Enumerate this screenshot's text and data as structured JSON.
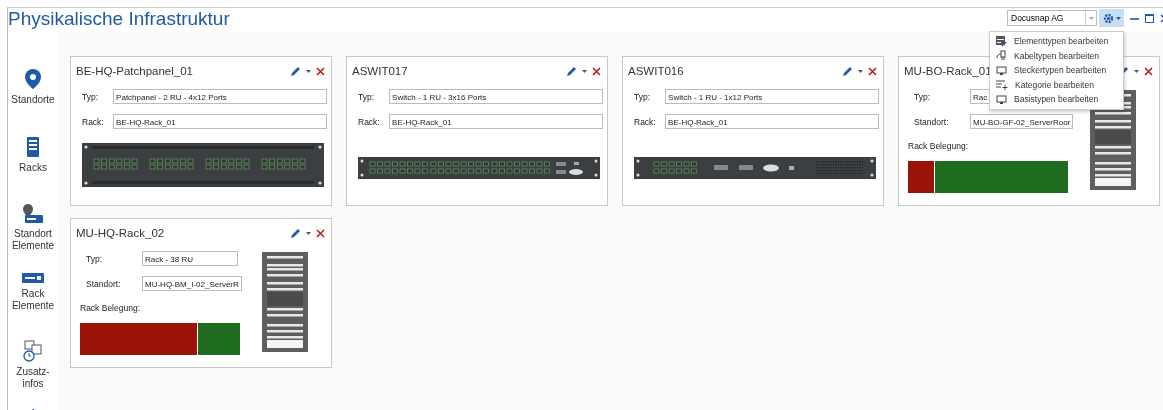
{
  "window": {
    "title": "Physikalische Infrastruktur"
  },
  "company_select": {
    "value": "Docusnap AG"
  },
  "settings_menu": {
    "expanded": true,
    "items": [
      {
        "label": "Elementtypen bearbeiten"
      },
      {
        "label": "Kabeltypen bearbeiten"
      },
      {
        "label": "Steckertypen bearbeiten"
      },
      {
        "label": "Kategorie bearbeiten"
      },
      {
        "label": "Basistypen bearbeiten"
      }
    ]
  },
  "sidebar": {
    "items": [
      {
        "label": "Standorte"
      },
      {
        "label": "Racks"
      },
      {
        "label": "Standort Elemente"
      },
      {
        "label": "Rack Elemente"
      },
      {
        "label": "Zusatz-infos"
      }
    ]
  },
  "cards": [
    {
      "kind": "patchpanel",
      "title": "BE-HQ-Patchpanel_01",
      "fields": [
        {
          "label": "Typ:",
          "value": "Patchpanel - 2 RU - 4x12 Ports"
        },
        {
          "label": "Rack:",
          "value": "BE-HQ-Rack_01"
        }
      ]
    },
    {
      "kind": "switch48",
      "title": "ASWIT017",
      "fields": [
        {
          "label": "Typ:",
          "value": "Switch - 1 RU - 3x16 Ports"
        },
        {
          "label": "Rack:",
          "value": "BE-HQ-Rack_01"
        }
      ]
    },
    {
      "kind": "switch12",
      "title": "ASWIT016",
      "fields": [
        {
          "label": "Typ:",
          "value": "Switch - 1 RU - 1x12 Ports"
        },
        {
          "label": "Rack:",
          "value": "BE-HQ-Rack_01"
        }
      ]
    },
    {
      "kind": "rack",
      "title": "MU-BO-Rack_01",
      "fields": [
        {
          "label": "Typ:",
          "value": "Rac"
        },
        {
          "label": "Standort:",
          "value": "MU-BO-GF-02_ServerRoor"
        }
      ],
      "occupancy": {
        "label": "Rack Belegung:",
        "level": 0.17
      }
    },
    {
      "kind": "rack",
      "title": "MU-HQ-Rack_02",
      "fields": [
        {
          "label": "Typ:",
          "value": "Rack - 38 RU"
        },
        {
          "label": "Standort:",
          "value": "MU-HQ-BM_I-02_ServerR"
        }
      ],
      "occupancy": {
        "label": "Rack Belegung:",
        "level": 0.74
      }
    }
  ]
}
